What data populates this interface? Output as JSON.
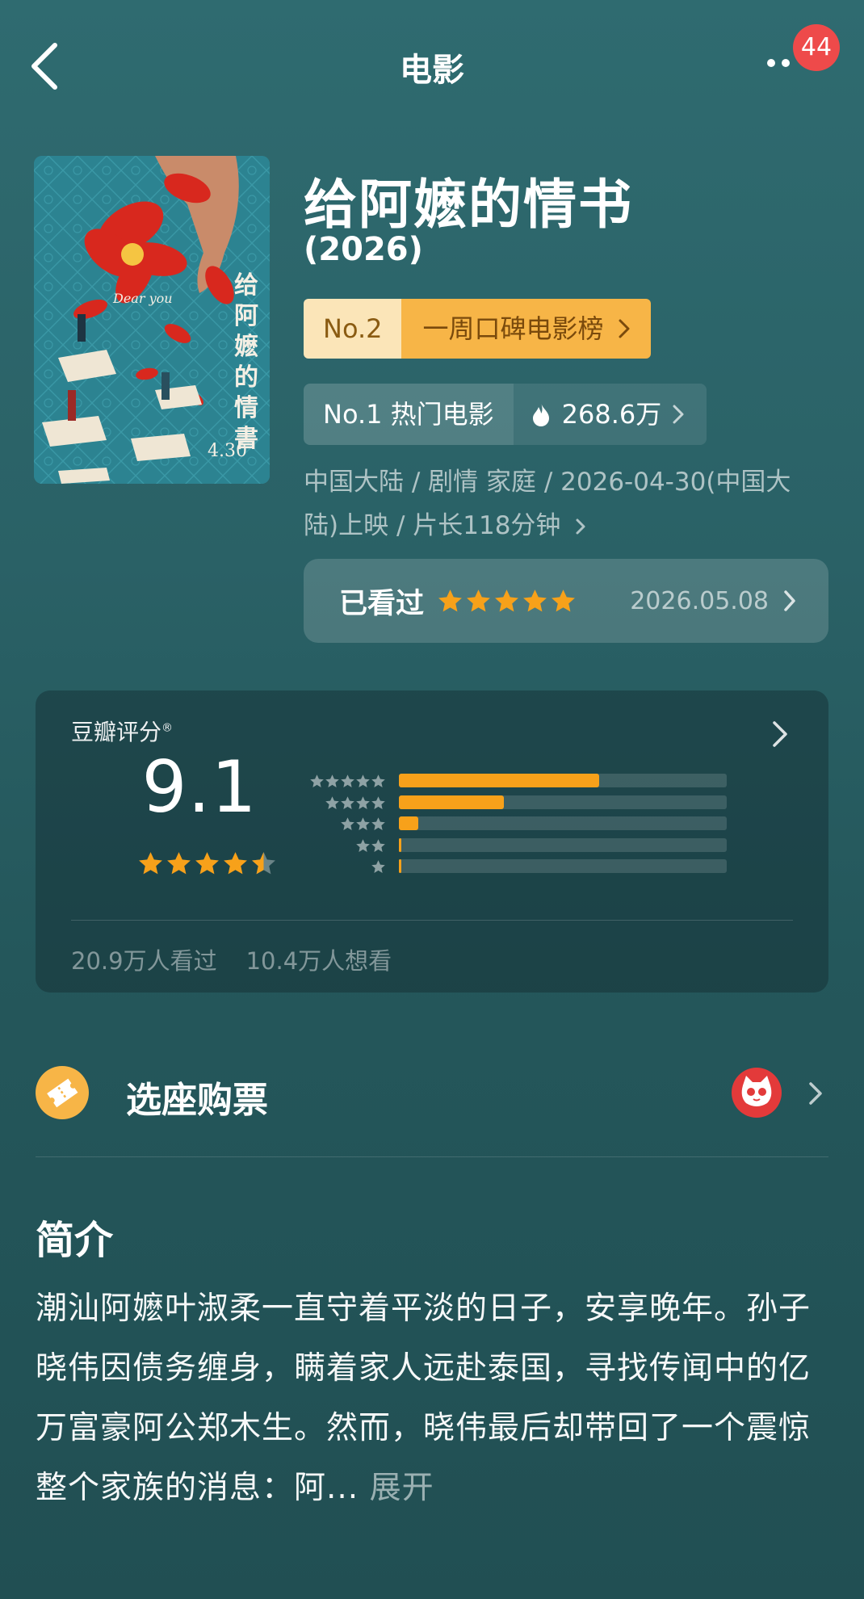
{
  "header": {
    "title": "电影",
    "notification_count": "44"
  },
  "movie": {
    "title": "给阿嬷的情书",
    "year": "(2026)",
    "rank_no": "No.2",
    "rank_list": "一周口碑电影榜",
    "hot_label": "No.1 热门电影",
    "hot_count": "268.6万",
    "meta": "中国大陆 / 剧情 家庭 / 2026-04-30(中国大陆)上映 / 片长118分钟",
    "poster_lines": [
      "给阿嬷的情书"
    ],
    "poster_date": "4.30",
    "poster_english": "Dear you"
  },
  "watched": {
    "label": "已看过",
    "stars": 5,
    "date": "2026.05.08"
  },
  "rating": {
    "label": "豆瓣评分",
    "reg": "®",
    "score": "9.1",
    "score_stars": 4.5,
    "distribution": [
      {
        "stars": 5,
        "fraction": 0.61
      },
      {
        "stars": 4,
        "fraction": 0.32
      },
      {
        "stars": 3,
        "fraction": 0.06
      },
      {
        "stars": 2,
        "fraction": 0.005
      },
      {
        "stars": 1,
        "fraction": 0.003
      }
    ],
    "watched_count": "20.9万人看过",
    "want_count": "10.4万人想看"
  },
  "ticket": {
    "label": "选座购票"
  },
  "intro": {
    "title": "简介",
    "text": "潮汕阿嬷叶淑柔一直守着平淡的日子，安享晚年。孙子晓伟因债务缠身，瞒着家人远赴泰国，寻找传闻中的亿万富豪阿公郑木生。然而，晓伟最后却带回了一个震惊整个家族的消息：阿...",
    "expand": "展开"
  },
  "colors": {
    "accent_orange": "#f7a11a",
    "rank_bg_light": "#fbe5b8",
    "rank_bg": "#f7b547",
    "badge_red": "#ee4a4a",
    "maoyan_red": "#e33a3a"
  }
}
